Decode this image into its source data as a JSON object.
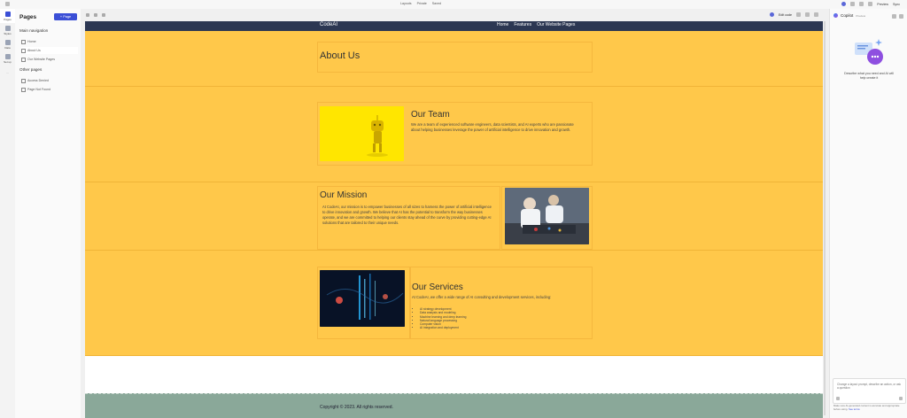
{
  "topbar": {
    "items": [
      "Layouts",
      "Private",
      "Saved"
    ],
    "preview": "Preview",
    "sync": "Sync"
  },
  "rail": [
    {
      "label": "Pages",
      "active": true
    },
    {
      "label": "Styles"
    },
    {
      "label": "Data"
    },
    {
      "label": "Set up"
    },
    {
      "label": "..."
    }
  ],
  "pages_panel": {
    "title": "Pages",
    "add_button": "+ Page",
    "main_nav_title": "Main navigation",
    "main_nav": [
      "Home",
      "About Us",
      "Our Website Pages"
    ],
    "other_title": "Other pages",
    "other": [
      "Access Denied",
      "Page Not Found"
    ]
  },
  "canvas_toolbar": {
    "edit_code": "Edit code"
  },
  "site": {
    "logo": "CodeAI",
    "nav": [
      "Home",
      "Features",
      "Our Website Pages"
    ],
    "about_title": "About Us",
    "team": {
      "title": "Our Team",
      "text": "We are a team of experienced software engineers, data scientists, and AI experts who are passionate about helping businesses leverage the power of artificial intelligence to drive innovation and growth."
    },
    "mission": {
      "title": "Our Mission",
      "text": "At CodeAI, our mission is to empower businesses of all sizes to harness the power of artificial intelligence to drive innovation and growth. We believe that AI has the potential to transform the way businesses operate, and we are committed to helping our clients stay ahead of the curve by providing cutting-edge AI solutions that are tailored to their unique needs."
    },
    "services": {
      "title": "Our Services",
      "text": "At CodeAI, we offer a wide range of AI consulting and development services, including:",
      "list": [
        "AI strategy development",
        "Data analysis and modeling",
        "Machine learning and deep learning",
        "Natural language processing",
        "Computer vision",
        "AI integration and deployment"
      ]
    },
    "footer": "Copyright © 2023. All rights reserved."
  },
  "copilot": {
    "title": "Copilot",
    "badge": "Preview",
    "desc": "Describe what you need and AI will help create it",
    "input_placeholder": "Change a layout prompt, describe an action, or ask a question",
    "note": "Make sure AI-generated content is accurate and appropriate before using.",
    "note_link": "See terms"
  },
  "colors": {
    "band": "#ffc84a",
    "header": "#2c3752",
    "footer": "#8aa899",
    "accent": "#3b4fd6"
  }
}
